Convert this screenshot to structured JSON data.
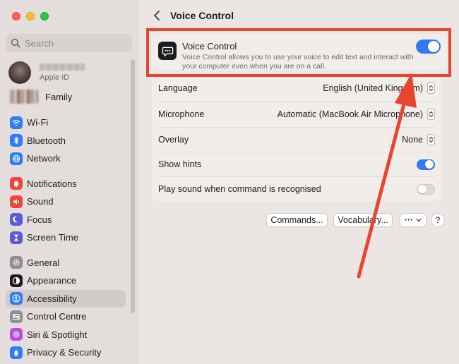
{
  "sidebar": {
    "search_placeholder": "Search",
    "account_sub": "Apple ID",
    "family_label": "Family",
    "groups": [
      [
        {
          "label": "Wi-Fi",
          "icon": "wifi-icon",
          "color": "#2f7cf6"
        },
        {
          "label": "Bluetooth",
          "icon": "bluetooth-icon",
          "color": "#2f7cf6"
        },
        {
          "label": "Network",
          "icon": "globe-icon",
          "color": "#2f7cf6"
        }
      ],
      [
        {
          "label": "Notifications",
          "icon": "bell-icon",
          "color": "#f0443a"
        },
        {
          "label": "Sound",
          "icon": "speaker-icon",
          "color": "#f0443a"
        },
        {
          "label": "Focus",
          "icon": "moon-icon",
          "color": "#5b5bd6"
        },
        {
          "label": "Screen Time",
          "icon": "hourglass-icon",
          "color": "#5b5bd6"
        }
      ],
      [
        {
          "label": "General",
          "icon": "gear-icon",
          "color": "#8e8e93"
        },
        {
          "label": "Appearance",
          "icon": "appearance-icon",
          "color": "#1c1c1e"
        },
        {
          "label": "Accessibility",
          "icon": "accessibility-icon",
          "color": "#2f7cf6",
          "active": true
        },
        {
          "label": "Control Centre",
          "icon": "control-centre-icon",
          "color": "#8e8e93"
        },
        {
          "label": "Siri & Spotlight",
          "icon": "siri-icon",
          "color": "#c04bd8"
        },
        {
          "label": "Privacy & Security",
          "icon": "hand-icon",
          "color": "#2f7cf6"
        }
      ]
    ]
  },
  "header": {
    "title": "Voice Control"
  },
  "voice_control": {
    "title": "Voice Control",
    "description": "Voice Control allows you to use your voice to edit text and interact with your computer even when you are on a call.",
    "enabled": true
  },
  "settings": {
    "language_label": "Language",
    "language_value": "English (United Kingdom)",
    "microphone_label": "Microphone",
    "microphone_value": "Automatic (MacBook Air Microphone)",
    "overlay_label": "Overlay",
    "overlay_value": "None",
    "hints_label": "Show hints",
    "hints_enabled": true,
    "sound_label": "Play sound when command is recognised",
    "sound_enabled": false
  },
  "buttons": {
    "commands": "Commands...",
    "vocabulary": "Vocabulary...",
    "more": "···",
    "help": "?"
  },
  "colors": {
    "accent": "#3478f6",
    "annotation": "#e8452f"
  }
}
